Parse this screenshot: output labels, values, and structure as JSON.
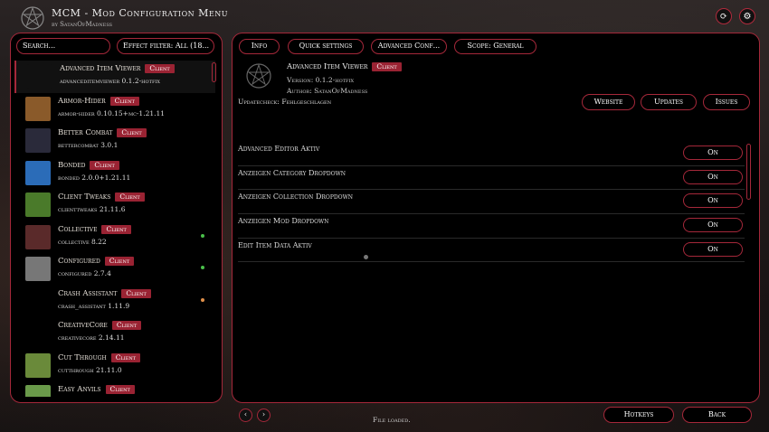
{
  "header": {
    "title": "MCM - Mod Configuration Menu",
    "subtitle": "by SatanOfMadness",
    "refresh_icon": "refresh-icon",
    "settings_icon": "gear-icon"
  },
  "left": {
    "search_placeholder": "Search...",
    "filter_label": "Effect filter: All (18..."
  },
  "mods": [
    {
      "name": "Advanced Item Viewer",
      "badge": "Client",
      "version": "advanceditemviewer  0.1.2-hotfix",
      "icon": "pentagram-icon",
      "color": "#111111",
      "dot": ""
    },
    {
      "name": "Armor-Hider",
      "badge": "Client",
      "version": "armor-hider  0.10.15+mc-1.21.11",
      "icon": "armor-icon",
      "color": "#8a5a2a",
      "dot": ""
    },
    {
      "name": "Better Combat",
      "badge": "Client",
      "version": "bettercombat  3.0.1",
      "icon": "better-combat-icon",
      "color": "#2a2a3a",
      "dot": ""
    },
    {
      "name": "Bonded",
      "badge": "Client",
      "version": "bonded  2.0.0+1.21.11",
      "icon": "bonded-t-icon",
      "color": "#2b6cb8",
      "dot": ""
    },
    {
      "name": "Client Tweaks",
      "badge": "Client",
      "version": "clienttweaks  21.11.6",
      "icon": "grass-block-icon",
      "color": "#4a7a2a",
      "dot": ""
    },
    {
      "name": "Collective",
      "badge": "Client",
      "version": "collective  8.22",
      "icon": "collective-icon",
      "color": "#5a2a2a",
      "dot": "#4ac04a"
    },
    {
      "name": "Configured",
      "badge": "Client",
      "version": "configured  2.7.4",
      "icon": "configured-icon",
      "color": "#777777",
      "dot": "#4ac04a"
    },
    {
      "name": "Crash Assistant",
      "badge": "Client",
      "version": "crash_assistant  1.11.9",
      "icon": "crash-assistant-icon",
      "color": "#000000",
      "dot": "#e0904a"
    },
    {
      "name": "CreativeCore",
      "badge": "Client",
      "version": "creativecore  2.14.11",
      "icon": "creativecore-icon",
      "color": "#000000",
      "dot": ""
    },
    {
      "name": "Cut Through",
      "badge": "Client",
      "version": "cutthrough  21.11.0",
      "icon": "ct-icon",
      "color": "#6a8a3a",
      "dot": ""
    },
    {
      "name": "Easy Anvils",
      "badge": "Client",
      "version": "",
      "icon": "easy-anvils-icon",
      "color": "#6a9a4a",
      "dot": ""
    }
  ],
  "tabs": [
    "Info",
    "Quick settings",
    "Advanced Conf...",
    "Scope: General"
  ],
  "mod_info": {
    "title": "Advanced Item Viewer",
    "badge": "Client",
    "version": "Version: 0.1.2-hotfix",
    "author": "Author: SatanOfMadness",
    "updatecheck": "Updatecheck: Fehlgeschlagen"
  },
  "links": [
    "Website",
    "Updates",
    "Issues"
  ],
  "settings": [
    {
      "label": "Advanced Editor Aktiv",
      "value": "On"
    },
    {
      "label": "Anzeigen Category Dropdown",
      "value": "On"
    },
    {
      "label": "Anzeigen Collection Dropdown",
      "value": "On"
    },
    {
      "label": "Anzeigen Mod Dropdown",
      "value": "On"
    },
    {
      "label": "Edit Item Data Aktiv",
      "value": "On"
    }
  ],
  "footer": {
    "prev": "‹",
    "next": "›",
    "status": "File loaded.",
    "hotkeys": "Hotkeys",
    "back": "Back"
  },
  "colors": {
    "accent": "#a5283a",
    "badge": "#9a2333"
  }
}
